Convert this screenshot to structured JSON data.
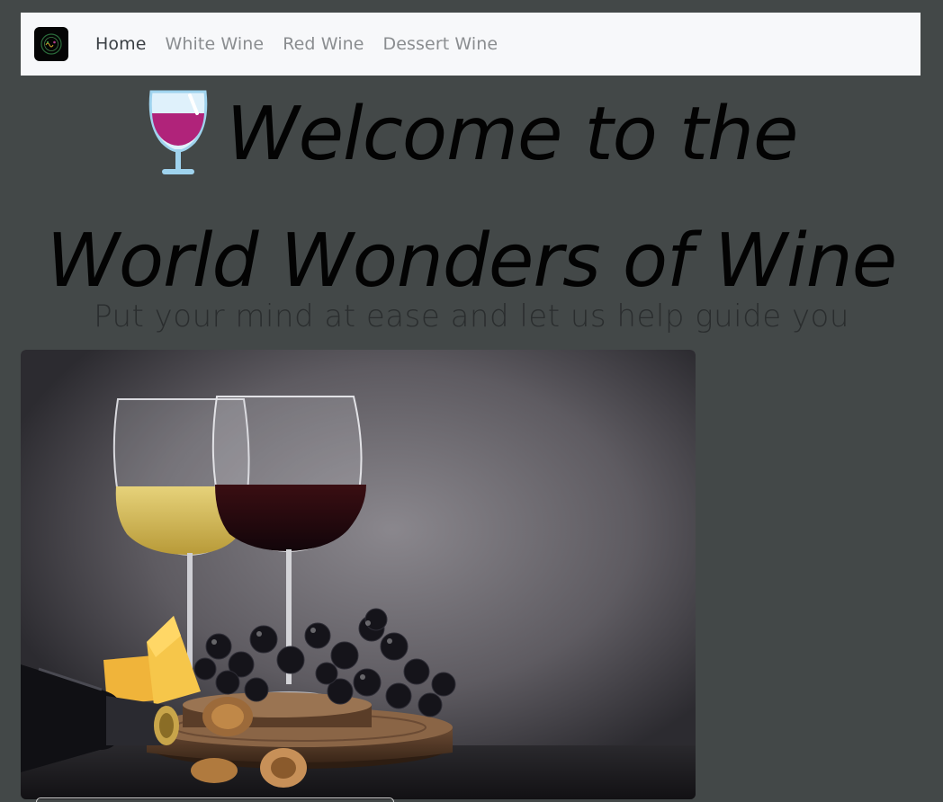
{
  "navbar": {
    "brand_icon": "wine-logo-icon",
    "links": [
      {
        "label": "Home",
        "active": true
      },
      {
        "label": "White Wine",
        "active": false
      },
      {
        "label": "Red Wine",
        "active": false
      },
      {
        "label": "Dessert Wine",
        "active": false
      }
    ]
  },
  "hero": {
    "title_line1": "Welcome to the",
    "title_line2": "World Wonders of Wine",
    "title_icon": "wine-glass-icon",
    "subtitle": "Put your mind at ease and let us help guide you"
  },
  "image": {
    "alt": "wine glasses with grapes, cheese and walnuts"
  },
  "colors": {
    "page_background": "#434848",
    "navbar_background": "#f7f8fa",
    "active_link": "#3a3f44",
    "inactive_link": "#8a8d90",
    "title_text": "#030303"
  }
}
